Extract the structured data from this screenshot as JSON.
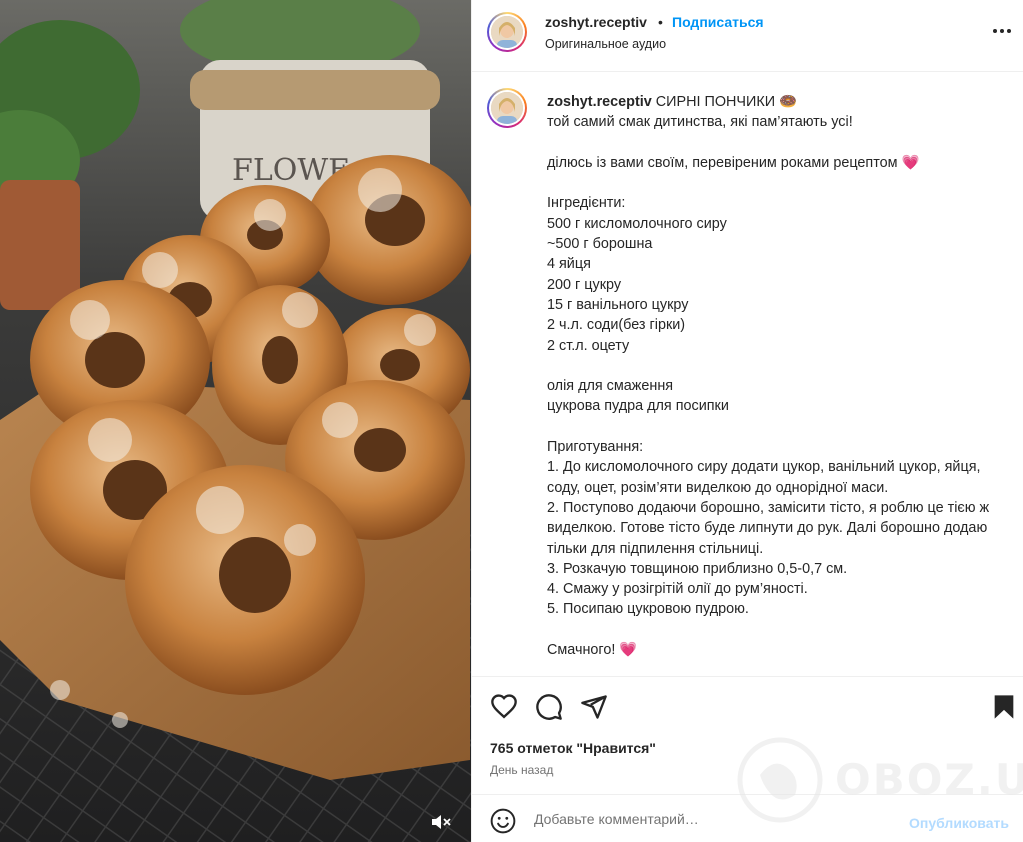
{
  "post": {
    "username": "zoshyt.receptiv",
    "separator": "•",
    "follow_label": "Подписаться",
    "audio_label": "Оригинальное аудио",
    "more_icon": "more-horizontal-icon"
  },
  "caption": {
    "username": "zoshyt.receptiv",
    "title": "СИРНІ ПОНЧИКИ 🍩",
    "body": "той самий смак дитинства, які пам’ятають усі!\n\nділюсь із вами своїм, перевіреним роками рецептом 💗\n\nІнгредієнти:\n500 г кисломолочного сиру\n~500 г борошна\n4 яйця\n200 г цукру\n15 г ванільного цукру\n2 ч.л. соди(без гірки)\n2 ст.л. оцету\n\nолія для смаження\nцукрова пудра для посипки\n\nПриготування:\n1. До кисломолочного сиру додати цукор, ванільний цукор, яйця, соду, оцет, розім’яти виделкою до однорідної маси.\n2. Поступово додаючи борошно, замісити тісто, я роблю це тією ж виделкою. Готове тісто буде липнути до рук. Далі борошно додаю тільки для підпилення стільниці.\n3. Розкачую товщиною приблизно 0,5-0,7 см.\n4. Смажу у розігрітій олії до рум’яності.\n5. Посипаю цукровою пудрою.\n\nСмачного! 💗"
  },
  "actions": {
    "icons": [
      "heart-icon",
      "comment-icon",
      "share-icon",
      "bookmark-icon"
    ],
    "likes_label": "765 отметок \"Нравится\"",
    "time_label": "День назад"
  },
  "comment_box": {
    "placeholder": "Добавьте комментарий…",
    "post_label": "Опубликовать",
    "emoji_icon": "emoji-icon"
  },
  "media": {
    "mute_icon": "speaker-muted-icon",
    "pot_label": "FLOWE"
  },
  "watermark": {
    "text": "OBOZ.UA"
  }
}
